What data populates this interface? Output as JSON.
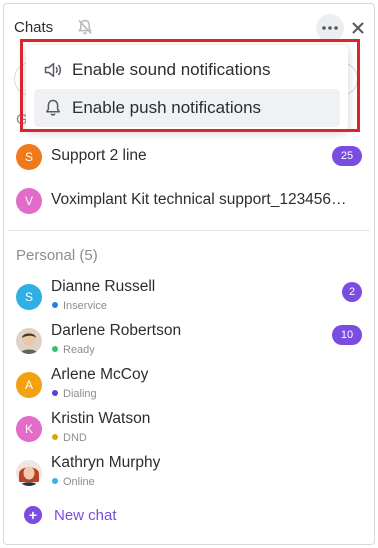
{
  "header": {
    "title": "Chats",
    "mute_icon": "bell-off-icon",
    "more_icon": "more-horizontal-icon",
    "close_icon": "close-icon"
  },
  "group_stub": {
    "label": "G"
  },
  "groups": [
    {
      "name": "Support 2 line",
      "initial": "S",
      "avatar_color": "#f07a1a",
      "badge": "25"
    },
    {
      "name": "Voximplant Kit technical support_123456…",
      "initial": "V",
      "avatar_color": "#e36bc9",
      "badge": ""
    }
  ],
  "personal": {
    "title": "Personal (5)",
    "contacts": [
      {
        "name": "Dianne Russell",
        "initial": "S",
        "avatar_color": "#2eb0e3",
        "status": "Inservice",
        "status_color": "#2b7de0",
        "badge": "2",
        "photo": false
      },
      {
        "name": "Darlene Robertson",
        "initial": "",
        "avatar_color": "#d9c8b8",
        "status": "Ready",
        "status_color": "#2fc46b",
        "badge": "10",
        "photo": true
      },
      {
        "name": "Arlene McCoy",
        "initial": "A",
        "avatar_color": "#f4a10f",
        "status": "Dialing",
        "status_color": "#5b3fd8",
        "badge": "",
        "photo": false
      },
      {
        "name": "Kristin Watson",
        "initial": "K",
        "avatar_color": "#e36bc9",
        "status": "DND",
        "status_color": "#e0a400",
        "badge": "",
        "photo": false
      },
      {
        "name": "Kathryn Murphy",
        "initial": "",
        "avatar_color": "#c9543a",
        "status": "Online",
        "status_color": "#3ab0e0",
        "badge": "",
        "photo": true
      }
    ]
  },
  "new_chat": {
    "label": "New chat",
    "icon": "plus-circle-icon"
  },
  "popup": {
    "items": [
      {
        "label": "Enable sound notifications",
        "icon": "speaker-icon"
      },
      {
        "label": "Enable push notifications",
        "icon": "bell-icon"
      }
    ]
  },
  "colors": {
    "accent": "#7a4ce0",
    "highlight_border": "#d9262c"
  }
}
